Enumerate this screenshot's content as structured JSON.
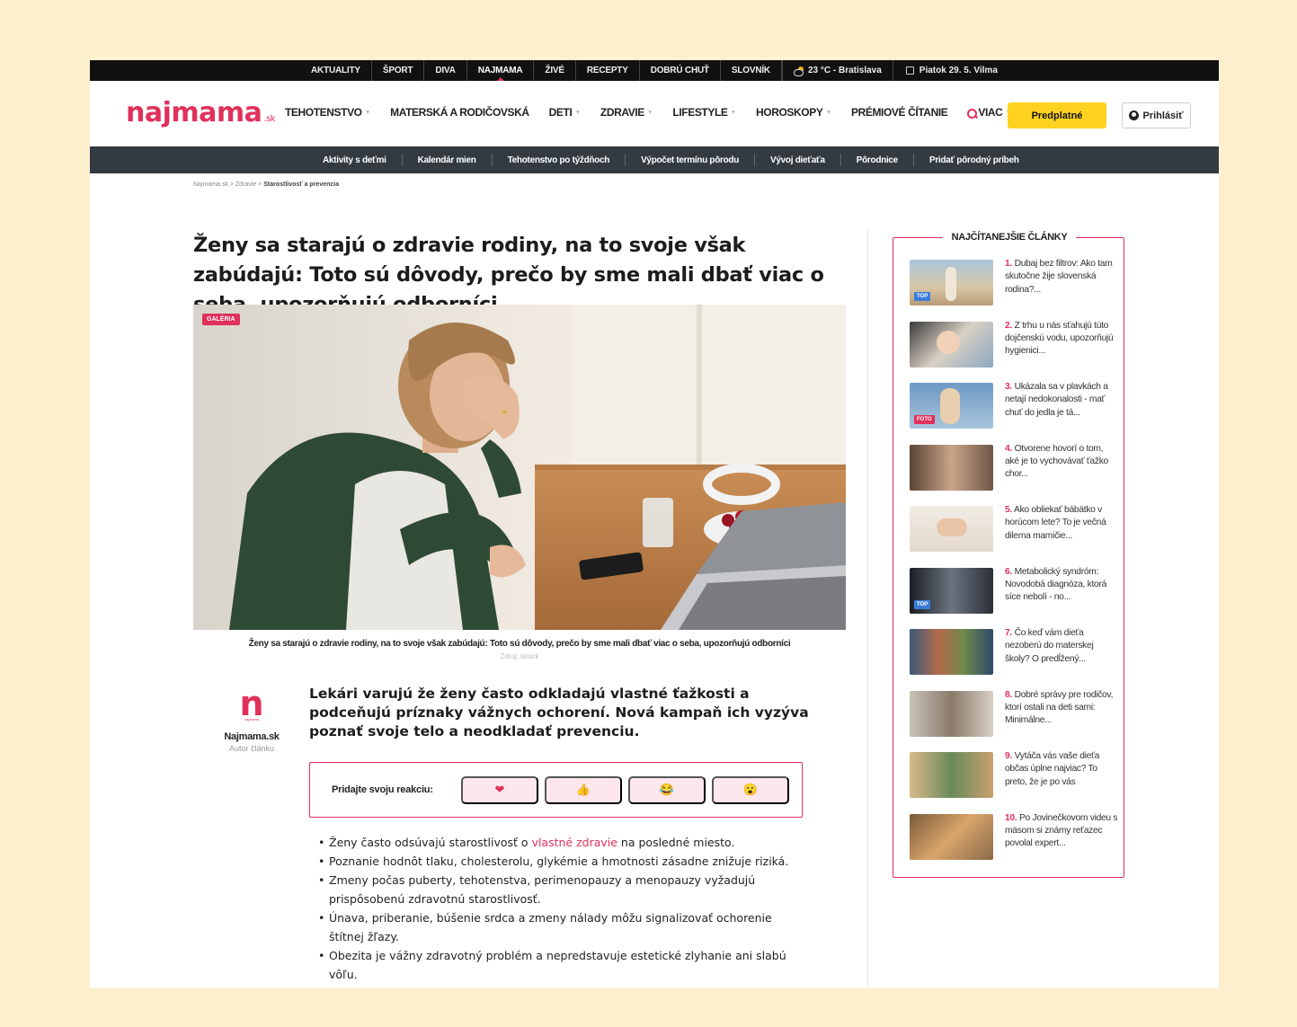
{
  "topbar": {
    "links": [
      {
        "label": "AKTUALITY",
        "active": false
      },
      {
        "label": "ŠPORT",
        "active": false
      },
      {
        "label": "DIVA",
        "active": false
      },
      {
        "label": "NAJMAMA",
        "active": true
      },
      {
        "label": "ŽIVÉ",
        "active": false
      },
      {
        "label": "RECEPTY",
        "active": false
      },
      {
        "label": "DOBRÚ CHUŤ",
        "active": false
      },
      {
        "label": "SLOVNÍK",
        "active": false
      }
    ],
    "weather": "23 °C - Bratislava",
    "date": "Piatok 29. 5.  Vilma"
  },
  "header": {
    "logo": "najmama",
    "logo_suffix": ".sk",
    "nav": [
      {
        "label": "TEHOTENSTVO",
        "dropdown": true
      },
      {
        "label": "MATERSKÁ A RODIČOVSKÁ",
        "dropdown": false
      },
      {
        "label": "DETI",
        "dropdown": true
      },
      {
        "label": "ZDRAVIE",
        "dropdown": true
      },
      {
        "label": "LIFESTYLE",
        "dropdown": true
      },
      {
        "label": "HOROSKOPY",
        "dropdown": true
      },
      {
        "label": "PRÉMIOVÉ ČÍTANIE",
        "dropdown": false
      },
      {
        "label": "VIAC",
        "dropdown": true
      }
    ],
    "subscribe_label": "Predplatné",
    "login_label": "Prihlásiť"
  },
  "subnav": [
    "Aktivity s deťmi",
    "Kalendár mien",
    "Tehotenstvo po týždňoch",
    "Výpočet termínu pôrodu",
    "Vývoj dieťaťa",
    "Pôrodnice",
    "Pridať pôrodný príbeh"
  ],
  "breadcrumb": {
    "items": [
      "Najmama.sk",
      "Zdravie"
    ],
    "current": "Starostlivosť a prevencia"
  },
  "article": {
    "title": "Ženy sa starajú o zdravie rodiny, na to svoje však zabúdajú: Toto sú dôvody, prečo by sme mali dbať viac o seba, upozorňujú odborníci",
    "badge": "GALÉRIA",
    "caption": "Ženy sa starajú o zdravie rodiny, na to svoje však zabúdajú: Toto sú dôvody, prečo by sme mali dbať viac o seba, upozorňujú odborníci",
    "source": "Zdroj: istock",
    "author_logo": "n",
    "author_logo_sub": "najmama",
    "author_name": "Najmama.sk",
    "author_role": "Autor článku",
    "lead": "Lekári varujú že ženy často odkladajú vlastné ťažkosti a podceňujú príznaky vážnych ochorení. Nová kampaň ich vyzýva poznať svoje telo a neodkladať prevenciu.",
    "reaction_label": "Pridajte svoju reakciu:",
    "reactions": [
      "❤",
      "👍",
      "😂",
      "😮"
    ],
    "bullets": [
      {
        "pre": "Ženy často odsúvajú starostlivosť o ",
        "link": "vlastné zdravie",
        "post": " na posledné miesto."
      },
      {
        "pre": "Poznanie hodnôt tlaku, cholesterolu, glykémie a hmotnosti zásadne znižuje riziká.",
        "link": "",
        "post": ""
      },
      {
        "pre": "Zmeny počas puberty, tehotenstva, perimenopauzy a menopauzy vyžadujú prispôsobenú zdravotnú starostlivosť.",
        "link": "",
        "post": ""
      },
      {
        "pre": "Únava, priberanie, búšenie srdca a zmeny nálady môžu signalizovať ochorenie štítnej žľazy.",
        "link": "",
        "post": ""
      },
      {
        "pre": "Obezita je vážny zdravotný problém a nepredstavuje estetické zlyhanie ani slabú vôľu.",
        "link": "",
        "post": ""
      }
    ]
  },
  "sidebar": {
    "title": "NAJČÍTANEJŠIE ČLÁNKY",
    "items": [
      {
        "num": "1.",
        "text": "Dubaj bez filtrov: Ako tam skutočne žije slovenská rodina?...",
        "tag": "TOP"
      },
      {
        "num": "2.",
        "text": "Z trhu u nás sťahujú túto dojčenskú vodu, upozorňujú hygienici...",
        "tag": ""
      },
      {
        "num": "3.",
        "text": "Ukázala sa v plavkách a netají nedokonalosti - mať chuť do jedla je tá...",
        "tag": "FOTO"
      },
      {
        "num": "4.",
        "text": "Otvorene hovorí o tom, aké je to vychovávať ťažko chor...",
        "tag": ""
      },
      {
        "num": "5.",
        "text": "Ako obliekať bábätko v horúcom lete? To je večná dilema mamičie...",
        "tag": ""
      },
      {
        "num": "6.",
        "text": "Metabolický syndróm: Novodobá diagnóza, ktorá síce nebolí - no...",
        "tag": "TOP"
      },
      {
        "num": "7.",
        "text": "Čo keď vám dieťa nezoberú do materskej školy? O predĺžený...",
        "tag": ""
      },
      {
        "num": "8.",
        "text": "Dobré správy pre rodičov, ktorí ostali na deti sami: Minimálne...",
        "tag": ""
      },
      {
        "num": "9.",
        "text": "Vytáča vás vaše dieťa občas úplne najviac? To preto, že je po vás",
        "tag": ""
      },
      {
        "num": "10.",
        "text": "Po Jovinečkovom videu s mäsom si známy reťazec povolal expert...",
        "tag": ""
      }
    ]
  }
}
